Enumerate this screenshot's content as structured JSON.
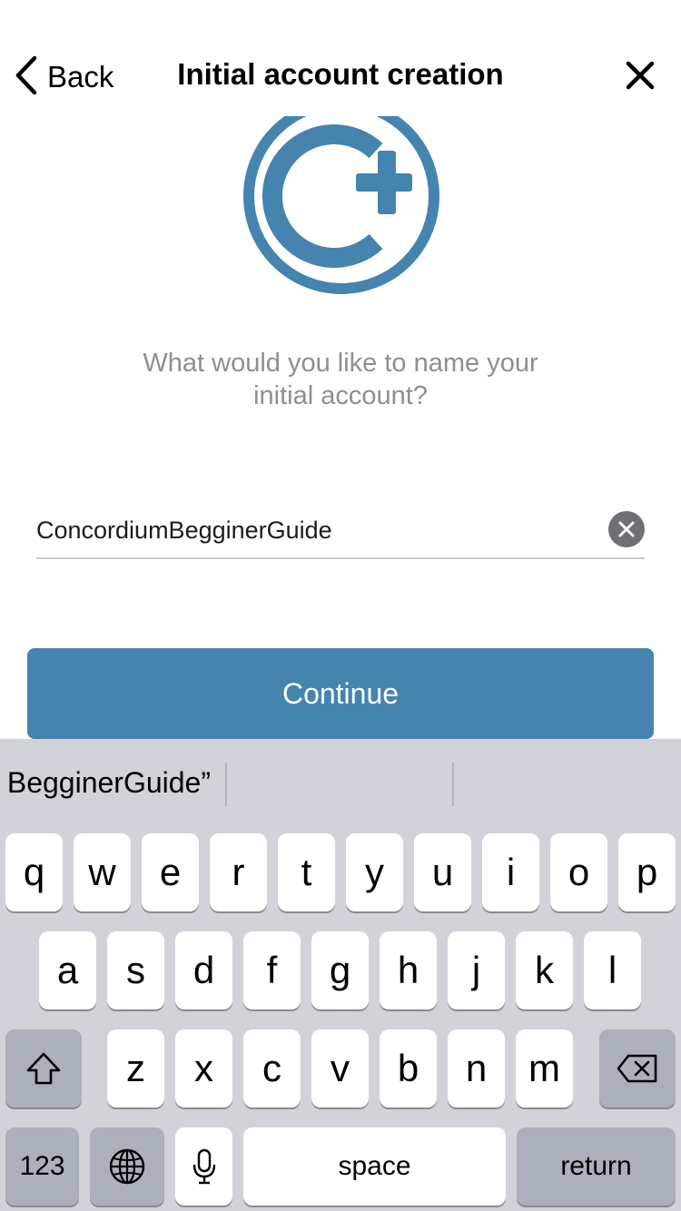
{
  "nav": {
    "back_label": "Back",
    "title": "Initial account creation",
    "back_icon": "chevron-left-icon",
    "close_icon": "close-icon"
  },
  "logo": {
    "icon": "concordium-logo",
    "color": "#4584ae"
  },
  "prompt": {
    "line1": "What would you like to name your",
    "line2": "initial account?"
  },
  "account_name": {
    "value": "ConcordiumBegginerGuide",
    "clear_icon": "clear-icon"
  },
  "continue_label": "Continue",
  "colors": {
    "accent": "#4584ae",
    "keyboard_bg": "#d1d3d9",
    "dark_key": "#acb0bb"
  },
  "keyboard": {
    "suggestion": "BegginerGuide”",
    "row1": [
      "q",
      "w",
      "e",
      "r",
      "t",
      "y",
      "u",
      "i",
      "o",
      "p"
    ],
    "row2": [
      "a",
      "s",
      "d",
      "f",
      "g",
      "h",
      "j",
      "k",
      "l"
    ],
    "row3": [
      "z",
      "x",
      "c",
      "v",
      "b",
      "n",
      "m"
    ],
    "numbers_label": "123",
    "space_label": "space",
    "return_label": "return",
    "shift_icon": "shift-icon",
    "delete_icon": "delete-icon",
    "globe_icon": "globe-icon",
    "mic_icon": "microphone-icon"
  }
}
